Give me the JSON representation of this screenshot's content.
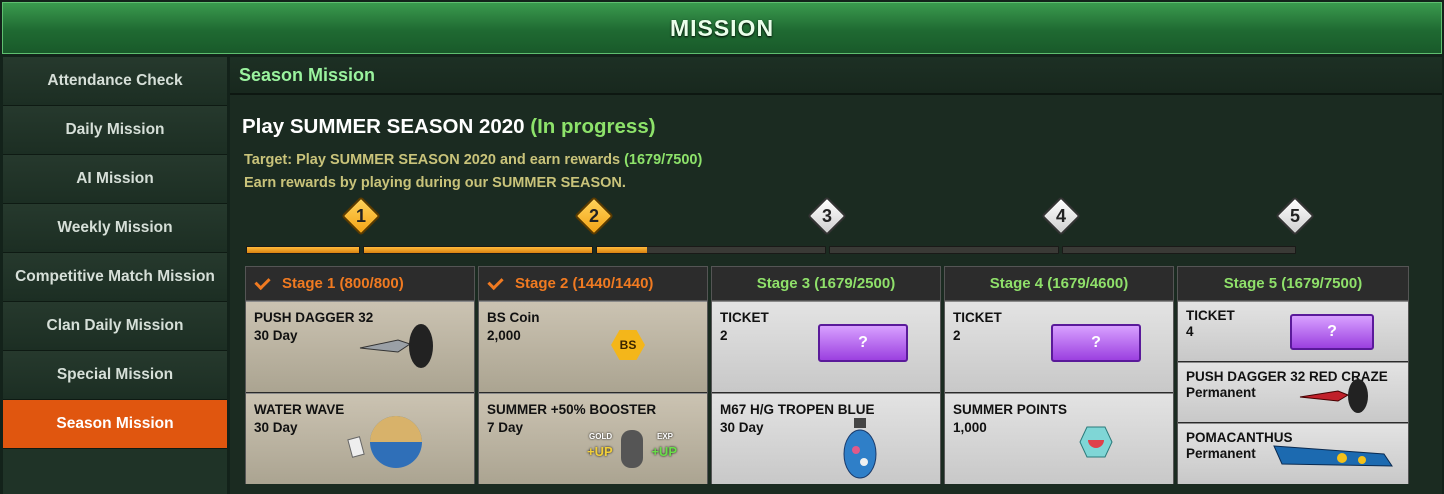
{
  "window": {
    "title": "MISSION"
  },
  "sidebar": {
    "items": [
      {
        "label": "Attendance Check"
      },
      {
        "label": "Daily Mission"
      },
      {
        "label": "AI Mission"
      },
      {
        "label": "Weekly Mission"
      },
      {
        "label": "Competitive Match Mission"
      },
      {
        "label": "Clan Daily Mission"
      },
      {
        "label": "Special Mission"
      },
      {
        "label": "Season Mission",
        "active": true
      }
    ]
  },
  "section": {
    "title": "Season Mission"
  },
  "mission": {
    "title": "Play SUMMER SEASON 2020",
    "status": "(In progress)",
    "target_prefix": "Target: Play SUMMER SEASON 2020 and earn rewards",
    "target_count": "(1679/7500)",
    "description": "Earn rewards by playing during our SUMMER SEASON."
  },
  "progress": {
    "fill_fractions": [
      1,
      1,
      0.22,
      0,
      0
    ]
  },
  "markers": [
    {
      "num": "1",
      "state": "done"
    },
    {
      "num": "2",
      "state": "done"
    },
    {
      "num": "3",
      "state": "todo"
    },
    {
      "num": "4",
      "state": "todo"
    },
    {
      "num": "5",
      "state": "todo"
    }
  ],
  "stages": [
    {
      "label": "Stage 1 (800/800)",
      "done": true,
      "rewards": [
        {
          "name": "PUSH DAGGER 32",
          "amount": "30 Day",
          "icon": "dagger-icon"
        },
        {
          "name": "WATER WAVE",
          "amount": "30 Day",
          "icon": "water-wave-icon"
        }
      ]
    },
    {
      "label": "Stage 2 (1440/1440)",
      "done": true,
      "rewards": [
        {
          "name": "BS Coin",
          "amount": "2,000",
          "icon": "bs-coin-icon",
          "icon_text": "BS"
        },
        {
          "name": "SUMMER +50% BOOSTER",
          "amount": "7 Day",
          "icon": "booster-icon",
          "icon_gold": "GOLD",
          "icon_exp": "EXP",
          "icon_up": "+UP"
        }
      ]
    },
    {
      "label": "Stage 3 (1679/2500)",
      "done": false,
      "rewards": [
        {
          "name": "TICKET",
          "amount": "2",
          "icon": "ticket-icon"
        },
        {
          "name": "M67 H/G TROPEN BLUE",
          "amount": "30 Day",
          "icon": "grenade-icon"
        }
      ]
    },
    {
      "label": "Stage 4 (1679/4600)",
      "done": false,
      "rewards": [
        {
          "name": "TICKET",
          "amount": "2",
          "icon": "ticket-icon"
        },
        {
          "name": "SUMMER POINTS",
          "amount": "1,000",
          "icon": "summer-points-icon"
        }
      ]
    },
    {
      "label": "Stage 5 (1679/7500)",
      "done": false,
      "rewards": [
        {
          "name": "TICKET",
          "amount": "4",
          "icon": "ticket-icon"
        },
        {
          "name": "PUSH DAGGER 32 RED CRAZE",
          "amount": "Permanent",
          "icon": "red-dagger-icon"
        },
        {
          "name": "POMACANTHUS",
          "amount": "Permanent",
          "icon": "pomacanthus-icon"
        }
      ]
    }
  ],
  "colors": {
    "accent_orange": "#e0560f",
    "progress_green": "#8de26a",
    "stage_done": "#f07a21",
    "title_green": "#9af39e"
  }
}
